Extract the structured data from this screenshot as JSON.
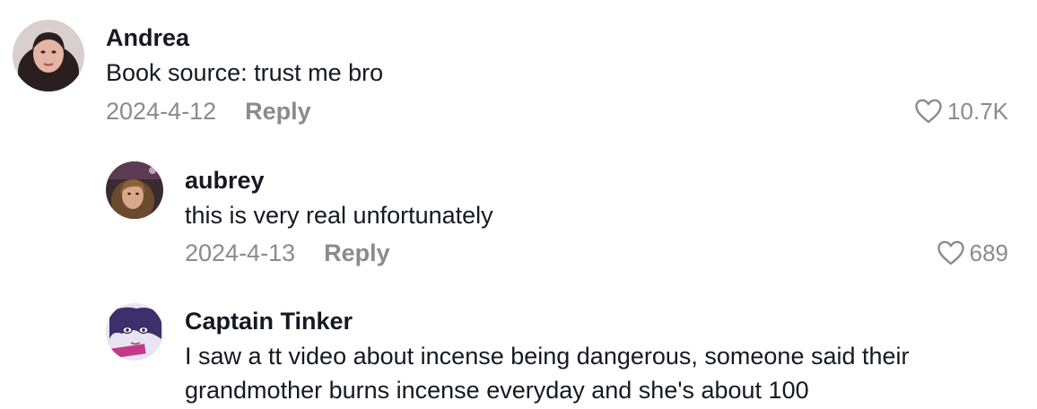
{
  "comments": [
    {
      "username": "Andrea",
      "text": "Book source: trust me bro",
      "date": "2024-4-12",
      "reply_label": "Reply",
      "likes": "10.7K",
      "avatar": "user-photo-avatar"
    },
    {
      "username": "aubrey",
      "text": "this is very real unfortunately",
      "date": "2024-4-13",
      "reply_label": "Reply",
      "likes": "689",
      "avatar": "user-photo-avatar"
    },
    {
      "username": "Captain Tinker",
      "text": "I saw a tt video about incense being dangerous, someone said their grandmother burns incense everyday and she's about 100",
      "avatar": "anime-art-avatar"
    }
  ],
  "colors": {
    "text": "#161823",
    "muted": "#8a8b91",
    "background": "#ffffff"
  },
  "icons": {
    "like": "heart-outline-icon"
  }
}
